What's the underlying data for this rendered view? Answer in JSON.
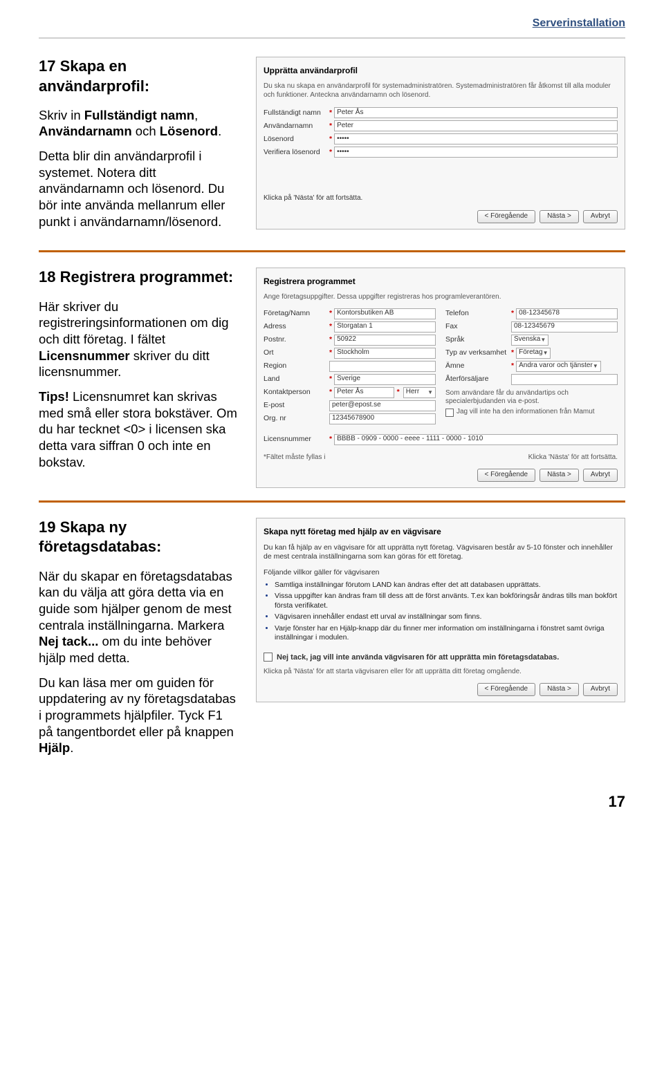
{
  "header": {
    "breadcrumb": "Serverinstallation"
  },
  "sec17": {
    "title": "17 Skapa en användarprofil:",
    "p1_pre": "Skriv in ",
    "p1_b1": "Fullständigt namn",
    "p1_mid1": ", ",
    "p1_b2": "Användarnamn",
    "p1_mid2": " och ",
    "p1_b3": "Lösenord",
    "p1_post": ".",
    "p2": "Detta blir din användarprofil i systemet. Notera ditt användarnamn och lösenord. Du bör inte använda mellanrum eller punkt i användarnamn/lösenord.",
    "shot_title": "Upprätta användarprofil",
    "shot_intro": "Du ska nu skapa en användarprofil för systemadministratören. Systemadministratören får åtkomst till alla moduler och funktioner. Anteckna användarnamn och lösenord.",
    "rows": [
      {
        "label": "Fullständigt namn",
        "value": "Peter Ås"
      },
      {
        "label": "Användarnamn",
        "value": "Peter"
      },
      {
        "label": "Lösenord",
        "value": "•••••"
      },
      {
        "label": "Verifiera lösenord",
        "value": "•••••"
      }
    ],
    "click_note": "Klicka på 'Nästa' för att fortsätta."
  },
  "sec18": {
    "title": "18 Registrera programmet:",
    "p1_pre": "Här skriver du registreringsinformationen om dig och ditt företag. I fältet ",
    "p1_b": "Licensnummer",
    "p1_post": " skriver du ditt licensnummer.",
    "p2_b": "Tips!",
    "p2": " Licensnumret kan skrivas med små eller stora bokstäver. Om du har tecknet <0> i licensen ska detta vara siffran 0 och inte en bokstav.",
    "shot_title": "Registrera programmet",
    "shot_intro": "Ange företagsuppgifter. Dessa uppgifter registreras hos programleverantören.",
    "left_rows": [
      {
        "label": "Företag/Namn",
        "value": "Kontorsbutiken AB"
      },
      {
        "label": "Adress",
        "value": "Storgatan 1"
      },
      {
        "label": "Postnr.",
        "value": "50922"
      },
      {
        "label": "Ort",
        "value": "Stockholm"
      },
      {
        "label": "Region",
        "value": ""
      },
      {
        "label": "Land",
        "value": "Sverige"
      },
      {
        "label": "Kontaktperson",
        "value": "Peter Ås",
        "extra": "Herr"
      },
      {
        "label": "E-post",
        "value": "peter@epost.se"
      },
      {
        "label": "Org. nr",
        "value": "12345678900"
      }
    ],
    "right_rows": [
      {
        "label": "Telefon",
        "value": "08-12345678"
      },
      {
        "label": "Fax",
        "value": "08-12345679"
      },
      {
        "label": "Språk",
        "value": "Svenska",
        "select": true
      },
      {
        "label": "Typ av verksamhet",
        "value": "Företag",
        "select": true
      },
      {
        "label": "Ämne",
        "value": "Andra varor och tjänster",
        "select": true
      },
      {
        "label": "Återförsäljare",
        "value": ""
      }
    ],
    "right_note": "Som användare får du användartips och specialerbjudanden via e-post.",
    "right_check": "Jag vill inte ha den informationen från Mamut",
    "license_label": "Licensnummer",
    "license_value": "BBBB - 0909 - 0000 - eeee - 1111 - 0000 - 1010",
    "req_note": "*Fältet måste fyllas i",
    "click_note": "Klicka 'Nästa' för att fortsätta."
  },
  "sec19": {
    "title": "19 Skapa ny företagsdatabas:",
    "p1_pre": "När du skapar en företagsdatabas kan du välja att göra detta via en guide som hjälper genom de mest centrala inställningarna. Markera ",
    "p1_b": "Nej tack...",
    "p1_post": " om du inte behöver hjälp med detta.",
    "p2_pre": "Du kan läsa mer om guiden för uppdatering av ny företagsdatabas i programmets hjälpfiler. Tyck F1 på tangentbordet eller på knappen ",
    "p2_b": "Hjälp",
    "p2_post": ".",
    "shot_title": "Skapa nytt företag med hjälp av en vägvisare",
    "intro": "Du kan få hjälp av en vägvisare för att upprätta nytt företag. Vägvisaren består av 5-10 fönster och innehåller de mest centrala inställningarna som kan göras för ett företag.",
    "sub": "Följande villkor gäller för vägvisaren",
    "bullets": [
      "Samtliga inställningar förutom LAND kan ändras efter det att databasen upprättats.",
      "Vissa uppgifter kan ändras fram till dess att de först använts. T.ex kan bokföringsår ändras tills man bokfört första verifikatet.",
      "Vägvisaren innehåller endast ett urval av inställningar som finns.",
      "Varje fönster har en Hjälp-knapp där du finner mer information om inställningarna i fönstret samt övriga inställningar i modulen."
    ],
    "checkbox": "Nej tack, jag vill inte använda vägvisaren för att upprätta min företagsdatabas.",
    "foot": "Klicka på 'Nästa' för att starta vägvisaren eller för att upprätta ditt företag omgående."
  },
  "buttons": {
    "prev": "< Föregående",
    "next": "Nästa >",
    "cancel": "Avbryt"
  },
  "page_number": "17"
}
